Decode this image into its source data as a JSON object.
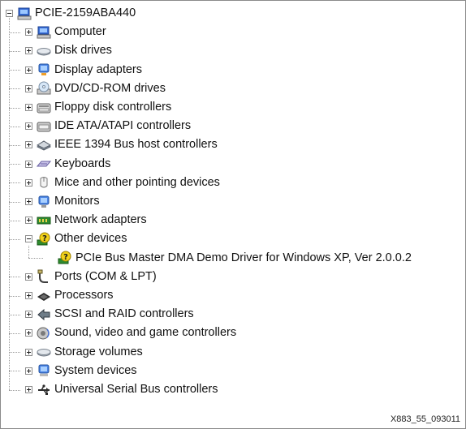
{
  "tree": {
    "root": {
      "label": "PCIE-2159ABA440",
      "icon": "computer-icon",
      "expanded": true
    },
    "items": [
      {
        "label": "Computer",
        "icon": "computer-icon",
        "expanded": false
      },
      {
        "label": "Disk drives",
        "icon": "disk-drive-icon",
        "expanded": false
      },
      {
        "label": "Display adapters",
        "icon": "display-adapter-icon",
        "expanded": false
      },
      {
        "label": "DVD/CD-ROM drives",
        "icon": "dvd-drive-icon",
        "expanded": false
      },
      {
        "label": "Floppy disk controllers",
        "icon": "floppy-controller-icon",
        "expanded": false
      },
      {
        "label": "IDE ATA/ATAPI controllers",
        "icon": "ide-controller-icon",
        "expanded": false
      },
      {
        "label": "IEEE 1394 Bus host controllers",
        "icon": "ieee1394-icon",
        "expanded": false
      },
      {
        "label": "Keyboards",
        "icon": "keyboard-icon",
        "expanded": false
      },
      {
        "label": "Mice and other pointing devices",
        "icon": "mouse-icon",
        "expanded": false
      },
      {
        "label": "Monitors",
        "icon": "monitor-icon",
        "expanded": false
      },
      {
        "label": "Network adapters",
        "icon": "network-adapter-icon",
        "expanded": false
      },
      {
        "label": "Other devices",
        "icon": "unknown-device-icon",
        "expanded": true,
        "children": [
          {
            "label": "PCIe Bus Master DMA Demo Driver for Windows XP, Ver 2.0.0.2",
            "icon": "unknown-device-icon"
          }
        ]
      },
      {
        "label": "Ports (COM & LPT)",
        "icon": "port-icon",
        "expanded": false
      },
      {
        "label": "Processors",
        "icon": "processor-icon",
        "expanded": false
      },
      {
        "label": "SCSI and RAID controllers",
        "icon": "scsi-icon",
        "expanded": false
      },
      {
        "label": "Sound, video and game controllers",
        "icon": "sound-icon",
        "expanded": false
      },
      {
        "label": "Storage volumes",
        "icon": "storage-volume-icon",
        "expanded": false
      },
      {
        "label": "System devices",
        "icon": "system-device-icon",
        "expanded": false
      },
      {
        "label": "Universal Serial Bus controllers",
        "icon": "usb-icon",
        "expanded": false
      }
    ]
  },
  "footnote": "X883_55_093011",
  "colors": {
    "connector": "#999999",
    "text": "#111111",
    "background": "#ffffff"
  }
}
